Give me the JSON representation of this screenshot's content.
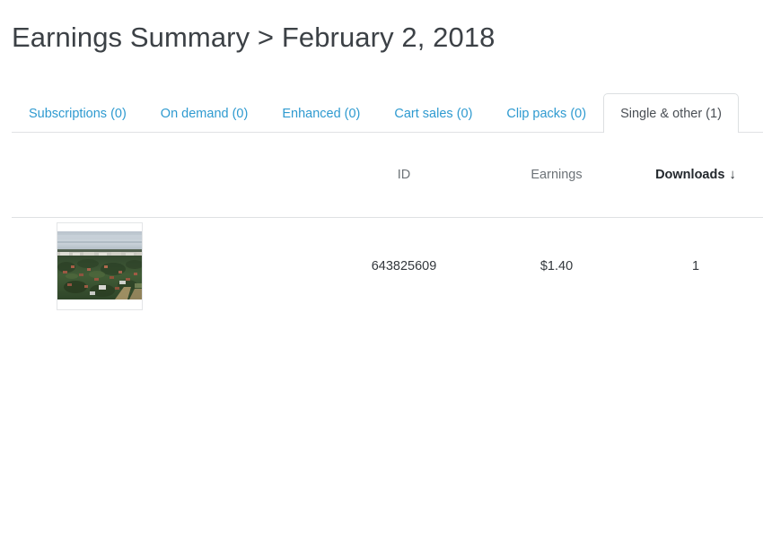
{
  "header": {
    "title": "Earnings Summary > February 2, 2018",
    "breadcrumb_root": "Earnings Summary",
    "breadcrumb_separator": ">",
    "breadcrumb_date": "February 2, 2018"
  },
  "tabs": [
    {
      "label": "Subscriptions (0)",
      "name": "tab-subscriptions",
      "count": 0,
      "active": false
    },
    {
      "label": "On demand (0)",
      "name": "tab-on-demand",
      "count": 0,
      "active": false
    },
    {
      "label": "Enhanced (0)",
      "name": "tab-enhanced",
      "count": 0,
      "active": false
    },
    {
      "label": "Cart sales (0)",
      "name": "tab-cart-sales",
      "count": 0,
      "active": false
    },
    {
      "label": "Clip packs (0)",
      "name": "tab-clip-packs",
      "count": 0,
      "active": false
    },
    {
      "label": "Single & other (1)",
      "name": "tab-single-and-other",
      "count": 1,
      "active": true
    }
  ],
  "table": {
    "columns": {
      "thumbnail": "",
      "id": "ID",
      "earnings": "Earnings",
      "downloads": "Downloads"
    },
    "sort": {
      "column": "Downloads",
      "direction": "descending",
      "arrow_glyph": "↓"
    },
    "rows": [
      {
        "thumbnail_alt": "aerial-photo-of-town-with-trees",
        "id": "643825609",
        "earnings": "$1.40",
        "downloads": "1"
      }
    ]
  },
  "colors": {
    "tab_link": "#2e9ad0",
    "tab_active_text": "#4a4f55",
    "title_text": "#3c4146",
    "header_text": "#6d7378",
    "sorted_header_text": "#23282d",
    "divider": "#dfe1e3",
    "page_background": "#ffffff"
  }
}
